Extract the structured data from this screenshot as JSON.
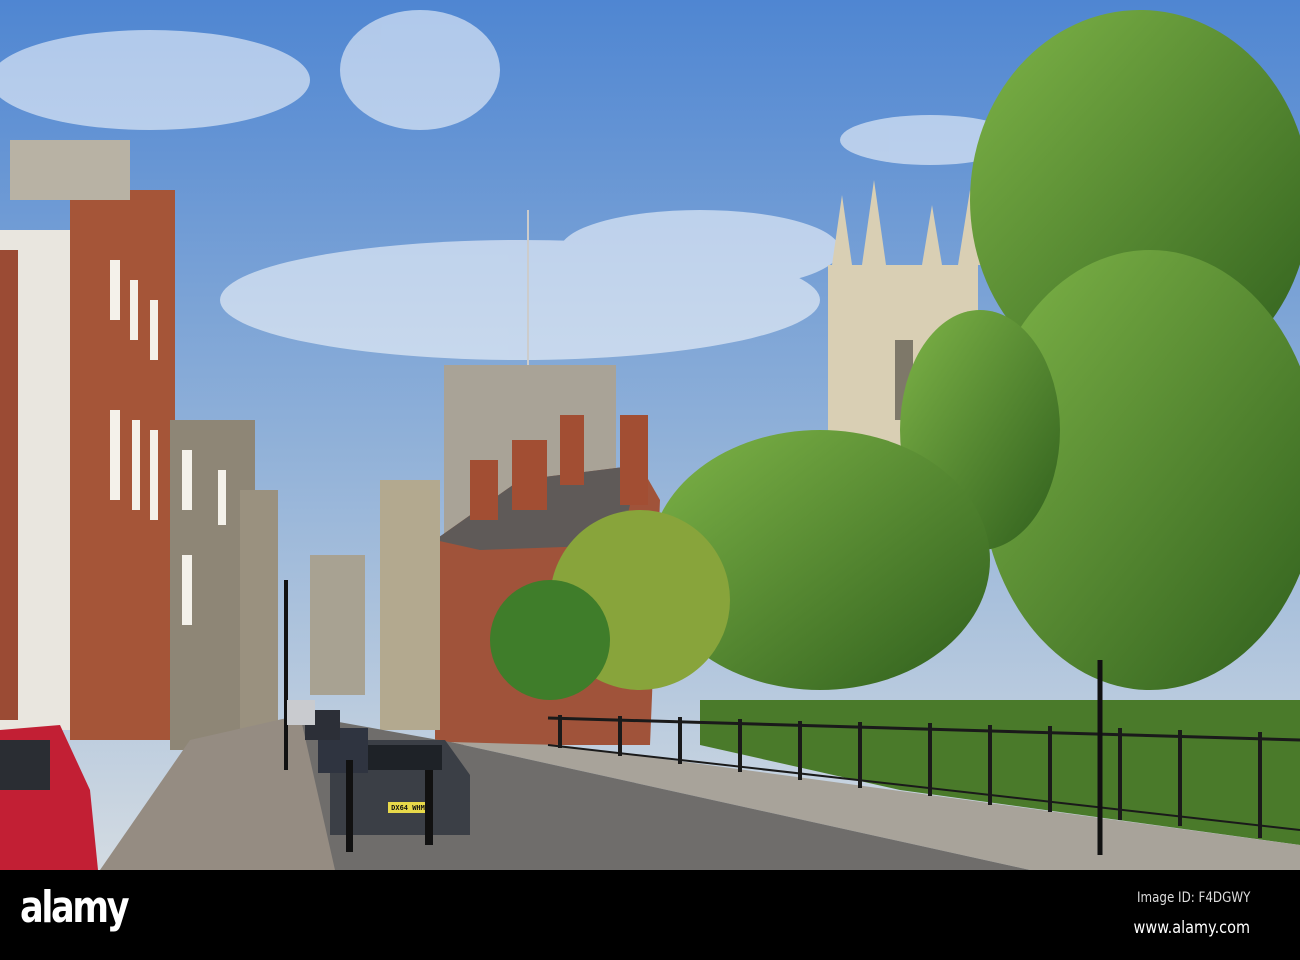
{
  "photo": {
    "subject": "street-scene",
    "car_plate": "DX64 WHM",
    "colors": {
      "sky_top": "#5b8fd6",
      "sky_bottom": "#c9d6e3",
      "brick": "#a5533a",
      "stone": "#b9ad98",
      "foliage": "#4f8a2c",
      "road": "#6f6d6b"
    }
  },
  "watermark": {
    "logo": "alamy",
    "image_id": "Image ID: F4DGWY",
    "website": "www.alamy.com"
  }
}
